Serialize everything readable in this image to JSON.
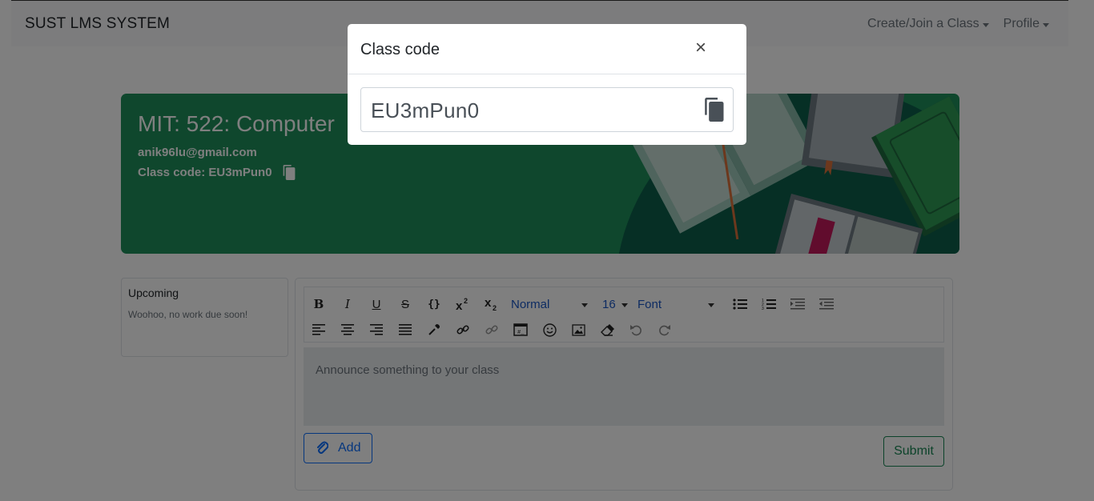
{
  "navbar": {
    "brand": "SUST LMS SYSTEM",
    "create_join": "Create/Join a Class",
    "profile": "Profile"
  },
  "banner": {
    "title": "MIT: 522: Computer",
    "email": "anik96lu@gmail.com",
    "class_code_label": "Class code: EU3mPun0",
    "copy_icon": "copy-icon",
    "background_color": "#1e8e5a"
  },
  "upcoming": {
    "title": "Upcoming",
    "text": "Woohoo, no work due soon!"
  },
  "editor": {
    "toolbar": {
      "bold": "B",
      "italic": "I",
      "underline": "U",
      "strike": "S",
      "code": "{}",
      "header_select": "Normal",
      "size_select": "16",
      "font_select": "Font"
    },
    "placeholder": "Announce something to your class",
    "add_label": "Add",
    "submit_label": "Submit"
  },
  "modal": {
    "title": "Class code",
    "close_glyph": "×",
    "code": "EU3mPun0",
    "copy_icon": "copy-icon"
  },
  "colors": {
    "primary": "#0d6efd",
    "success": "#198754",
    "banner_green": "#1e8e5a"
  }
}
